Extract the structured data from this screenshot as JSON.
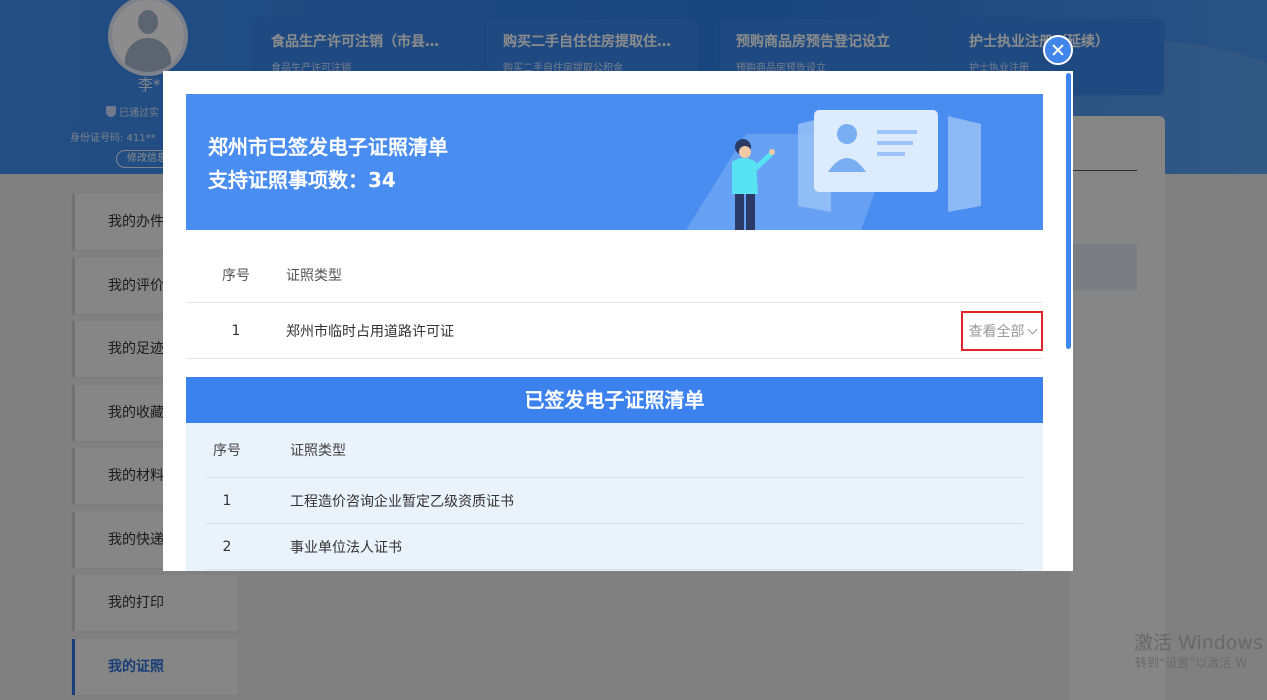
{
  "user": {
    "name": "李*",
    "verified": "已通过实",
    "id_label": "身份证号码: 411**",
    "edit_label": "修改信息"
  },
  "service_cards": [
    {
      "title": "食品生产许可注销（市县…",
      "subtitle": "食品生产许可注销"
    },
    {
      "title": "购买二手自住住房提取住…",
      "subtitle": "购买二手自住房提取公积金"
    },
    {
      "title": "预购商品房预告登记设立",
      "subtitle": "预购商品房预告设立"
    },
    {
      "title": "护士执业注册（延续）",
      "subtitle": "护士执业注册"
    }
  ],
  "side_menu": [
    {
      "label": "我的办件",
      "active": false
    },
    {
      "label": "我的评价",
      "active": false
    },
    {
      "label": "我的足迹",
      "active": false
    },
    {
      "label": "我的收藏",
      "active": false
    },
    {
      "label": "我的材料",
      "active": false
    },
    {
      "label": "我的快递",
      "active": false
    },
    {
      "label": "我的打印",
      "active": false
    },
    {
      "label": "我的证照",
      "active": true
    }
  ],
  "modal": {
    "banner_title": "郑州市已签发电子证照清单",
    "banner_count": "支持证照事项数：34",
    "table1": {
      "headers": {
        "no": "序号",
        "type": "证照类型"
      },
      "rows": [
        {
          "no": "1",
          "type": "郑州市临时占用道路许可证",
          "action": "查看全部"
        }
      ]
    },
    "section2": {
      "title": "已签发电子证照清单",
      "headers": {
        "no": "序号",
        "type": "证照类型"
      },
      "rows": [
        {
          "no": "1",
          "type": "工程造价咨询企业暂定乙级资质证书"
        },
        {
          "no": "2",
          "type": "事业单位法人证书"
        }
      ]
    }
  },
  "windows_watermark": {
    "title": "激活 Windows",
    "subtitle": "转到“设置”以激活 W"
  },
  "colors": {
    "brand_blue": "#3b82ef",
    "highlight_red": "#e0262c",
    "active_menu": "#2f73d8"
  }
}
